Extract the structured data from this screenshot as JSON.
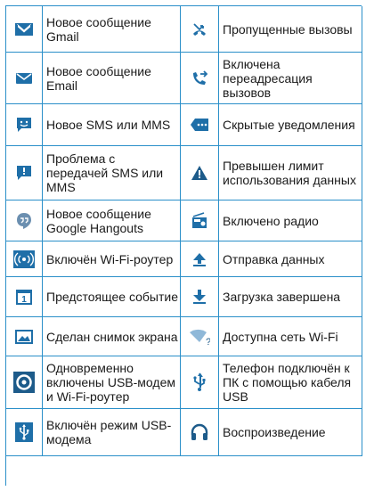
{
  "colors": {
    "border": "#2a8fc9",
    "icon_blue": "#1f6fa8",
    "icon_dark": "#1d5b8a"
  },
  "rows": [
    {
      "left": {
        "icon": "gmail-icon",
        "text": "Новое сообщение Gmail"
      },
      "right": {
        "icon": "missed-call-icon",
        "text": "Пропущенные вызовы"
      }
    },
    {
      "left": {
        "icon": "email-icon",
        "text": "Новое сообщение Email"
      },
      "right": {
        "icon": "call-forward-icon",
        "text": "Включена переадресация вызовов"
      }
    },
    {
      "left": {
        "icon": "sms-icon",
        "text": "Новое SMS или MMS"
      },
      "right": {
        "icon": "more-notifications-icon",
        "text": "Скрытые уведомления"
      }
    },
    {
      "left": {
        "icon": "sms-error-icon",
        "text": "Проблема с передачей SMS или MMS"
      },
      "right": {
        "icon": "warning-icon",
        "text": "Превышен лимит использования данных"
      }
    },
    {
      "left": {
        "icon": "hangouts-icon",
        "text": "Новое сообщение Google Hangouts"
      },
      "right": {
        "icon": "radio-icon",
        "text": "Включено радио"
      }
    },
    {
      "left": {
        "icon": "wifi-hotspot-icon",
        "text": "Включён Wi-Fi-роутер"
      },
      "right": {
        "icon": "upload-icon",
        "text": "Отправка данных"
      }
    },
    {
      "left": {
        "icon": "calendar-icon",
        "text": "Предстоящее событие"
      },
      "right": {
        "icon": "download-icon",
        "text": "Загрузка завершена"
      }
    },
    {
      "left": {
        "icon": "screenshot-icon",
        "text": "Сделан снимок экрана"
      },
      "right": {
        "icon": "wifi-available-icon",
        "text": "Доступна сеть Wi-Fi"
      }
    },
    {
      "left": {
        "icon": "usb-wifi-tethering-icon",
        "text": "Одновременно включены USB-модем и Wi-Fi-роутер"
      },
      "right": {
        "icon": "usb-connected-icon",
        "text": "Телефон подключён к ПК с помощью кабеля USB"
      }
    },
    {
      "left": {
        "icon": "usb-tethering-icon",
        "text": "Включён режим USB-модема"
      },
      "right": {
        "icon": "headphones-icon",
        "text": "Воспроизведение"
      }
    }
  ]
}
